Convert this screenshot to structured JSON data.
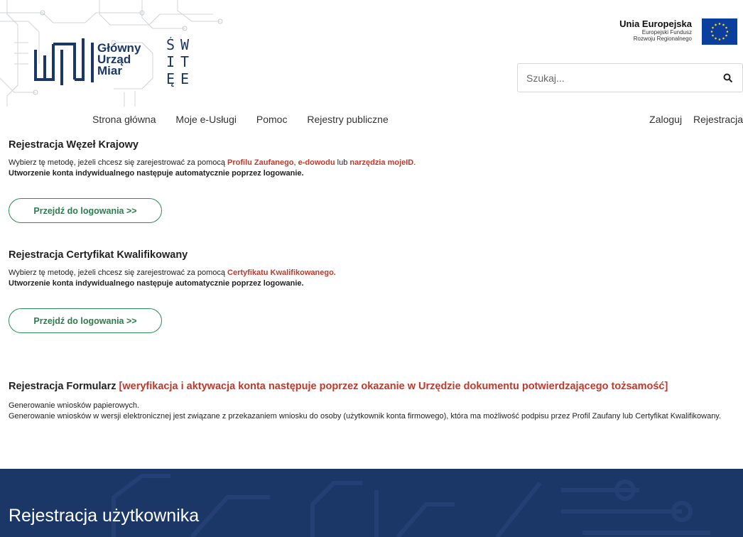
{
  "header": {
    "logo_lines": [
      "Główny",
      "Urząd",
      "Miar"
    ],
    "swiete_letters": [
      "Ś",
      "W",
      "I",
      "Ę",
      "T",
      "E"
    ],
    "eu": {
      "title": "Unia Europejska",
      "sub1": "Europejski Fundusz",
      "sub2": "Rozwoju Regionalnego",
      "flag_color": "#0a3f9e",
      "star_color": "#f7d117"
    },
    "search": {
      "placeholder": "Szukaj...",
      "icon": "search-icon"
    }
  },
  "nav": {
    "left": [
      "Strona główna",
      "Moje e-Usługi",
      "Pomoc",
      "Rejestry publiczne"
    ],
    "right": [
      "Zaloguj",
      "Rejestracja"
    ]
  },
  "sections": {
    "wezel": {
      "title": "Rejestracja Węzeł Krajowy",
      "text_pre": "Wybierz tę metodę, jeżeli chcesz się zarejestrować za pomocą ",
      "link1": "Profilu Zaufanego",
      "sep1": ", ",
      "link2": "e-dowodu",
      "sep2": " lub ",
      "link3": "narzędzia mojeID",
      "text_end": ".",
      "note": "Utworzenie konta indywidualnego następuje automatycznie poprzez logowanie.",
      "button": "Przejdź do logowania >>"
    },
    "certyfikat": {
      "title": "Rejestracja Certyfikat Kwalifikowany",
      "text_pre": "Wybierz tę metodę, jeżeli chcesz się zarejestrować za pomocą ",
      "link1": "Certyfikatu Kwalifikowanego.",
      "note": "Utworzenie konta indywidualnego następuje automatycznie poprzez logowanie.",
      "button": "Przejdź do logowania >>"
    },
    "formularz": {
      "title": "Rejestracja Formularz",
      "title_red": "[weryfikacja i aktywacja konta następuje poprzez okazanie w Urzędzie dokumentu potwierdzającego tożsamość]",
      "line1": "Generowanie wniosków papierowych.",
      "line2": "Generowanie wniosków w wersji elektronicznej jest związane z przekazaniem wniosku do osoby (użytkownik konta firmowego), która ma możliwość podpisu przez Profil Zaufany lub Certyfikat Kwalifikowany."
    }
  },
  "footer": {
    "title": "Rejestracja użytkownika",
    "bg_color": "#1b3768"
  },
  "colors": {
    "accent_red": "#c0392b",
    "button_green": "#2e8b57",
    "brand_navy": "#1b3768"
  }
}
